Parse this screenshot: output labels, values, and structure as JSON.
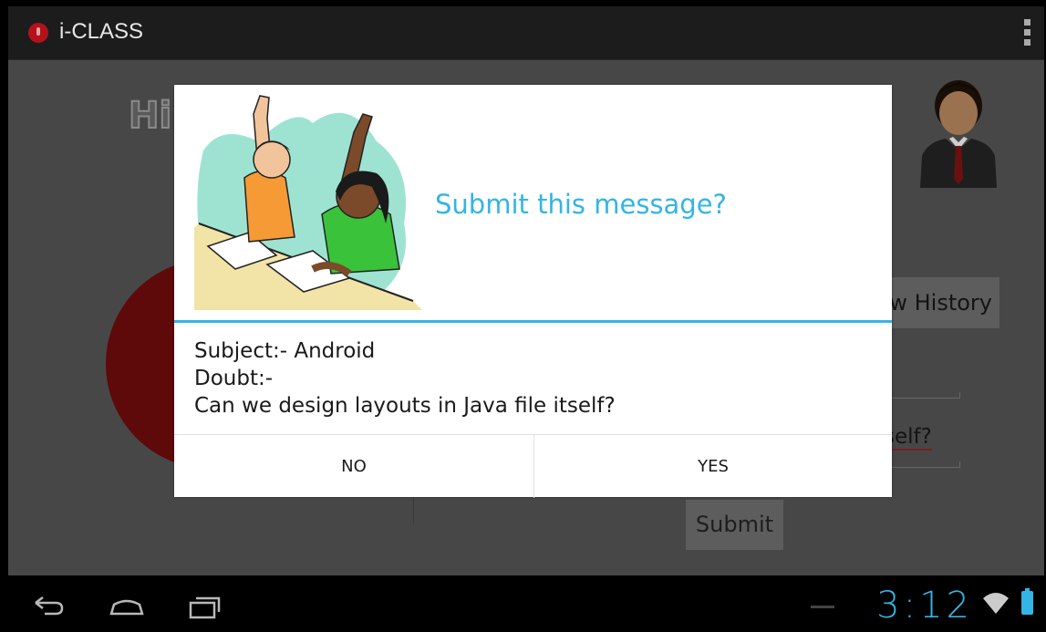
{
  "app": {
    "title": "i-CLASS"
  },
  "background": {
    "greeting": "Hi",
    "history_button": "w History",
    "field_text_visible": "self?",
    "submit_button": "Submit"
  },
  "dialog": {
    "title": "Submit this message?",
    "subject_line": "Subject:- Android",
    "doubt_label": "Doubt:-",
    "doubt_text": "Can we design layouts in Java file itself?",
    "no_button": "NO",
    "yes_button": "YES"
  },
  "status": {
    "clock": "3:12"
  },
  "colors": {
    "accent": "#33b5e5",
    "brand_red": "#b3121b"
  },
  "icons": [
    "app-logo-icon",
    "overflow-menu-icon",
    "back-icon",
    "home-icon",
    "recent-apps-icon",
    "wifi-icon",
    "battery-icon",
    "user-avatar-icon"
  ]
}
